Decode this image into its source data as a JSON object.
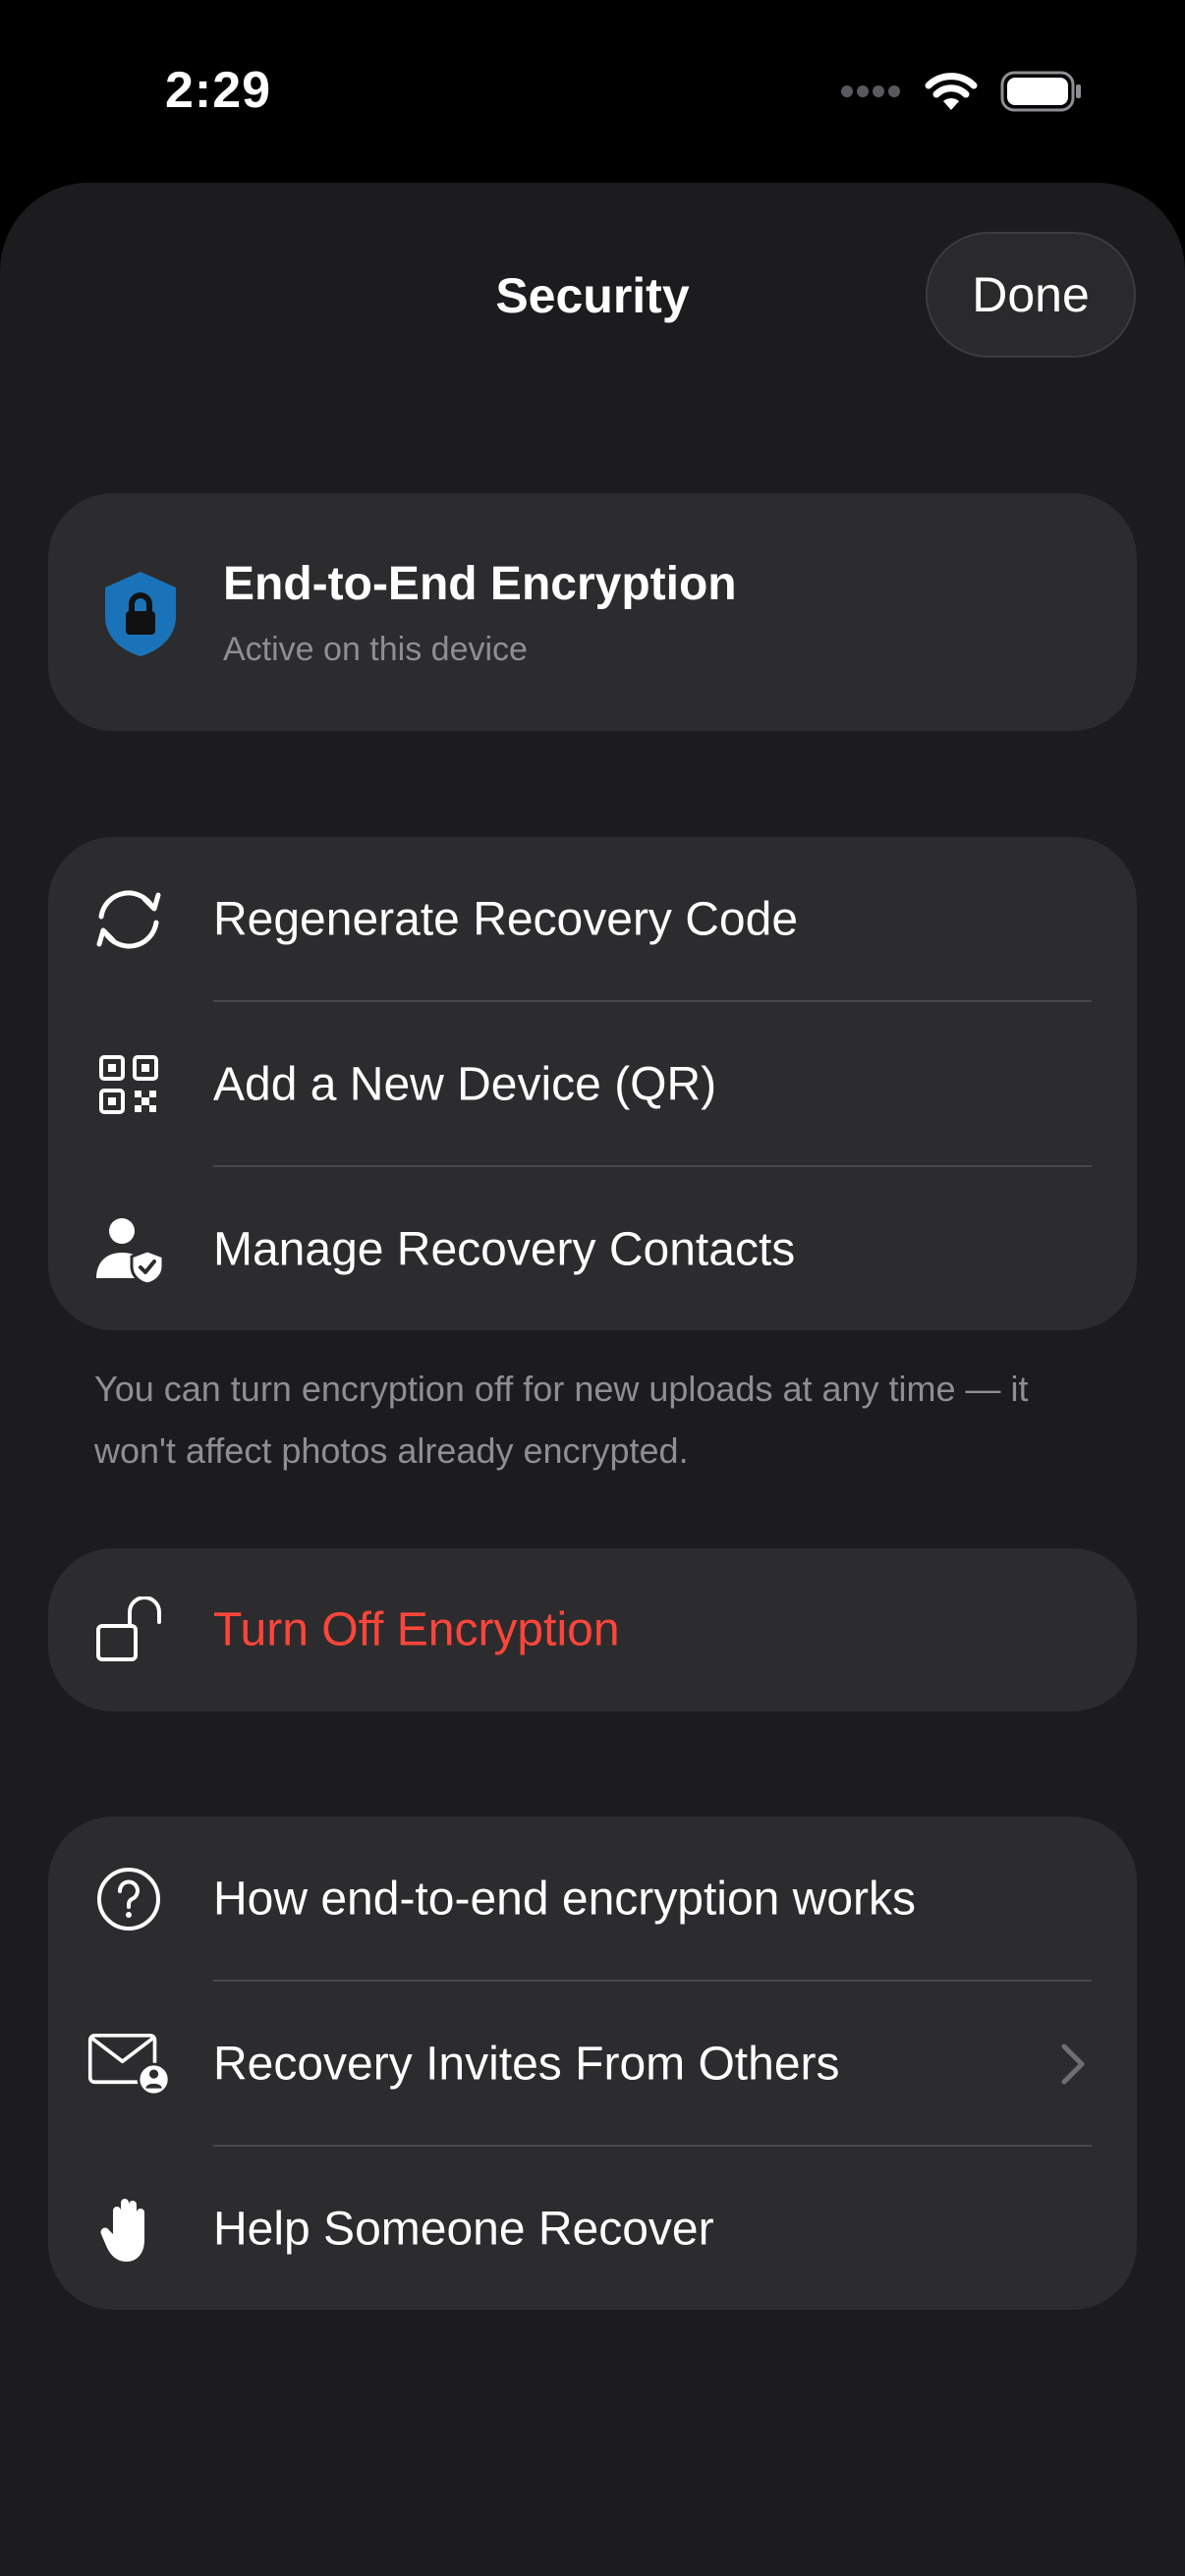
{
  "status_bar": {
    "time": "2:29"
  },
  "nav": {
    "title": "Security",
    "done_label": "Done"
  },
  "encryption_status": {
    "title": "End-to-End Encryption",
    "subtitle": "Active on this device",
    "icon": "shield-lock-icon",
    "icon_color": "#1a73b8"
  },
  "actions": [
    {
      "label": "Regenerate Recovery Code",
      "icon": "refresh-icon"
    },
    {
      "label": "Add a New Device (QR)",
      "icon": "qr-code-icon"
    },
    {
      "label": "Manage Recovery Contacts",
      "icon": "person-shield-icon"
    }
  ],
  "footnote": "You can turn encryption off for new uploads at any time — it won't affect photos already encrypted.",
  "turn_off": {
    "label": "Turn Off Encryption",
    "icon": "unlock-icon",
    "color": "#ff453a"
  },
  "help": [
    {
      "label": "How end-to-end encryption works",
      "icon": "question-circle-icon"
    },
    {
      "label": "Recovery Invites From Others",
      "icon": "envelope-person-icon"
    },
    {
      "label": "Help Someone Recover",
      "icon": "hand-icon"
    }
  ],
  "colors": {
    "background": "#1c1c1e",
    "card": "#2c2c2e",
    "secondary_text": "#8e8e93",
    "danger": "#ff453a"
  }
}
